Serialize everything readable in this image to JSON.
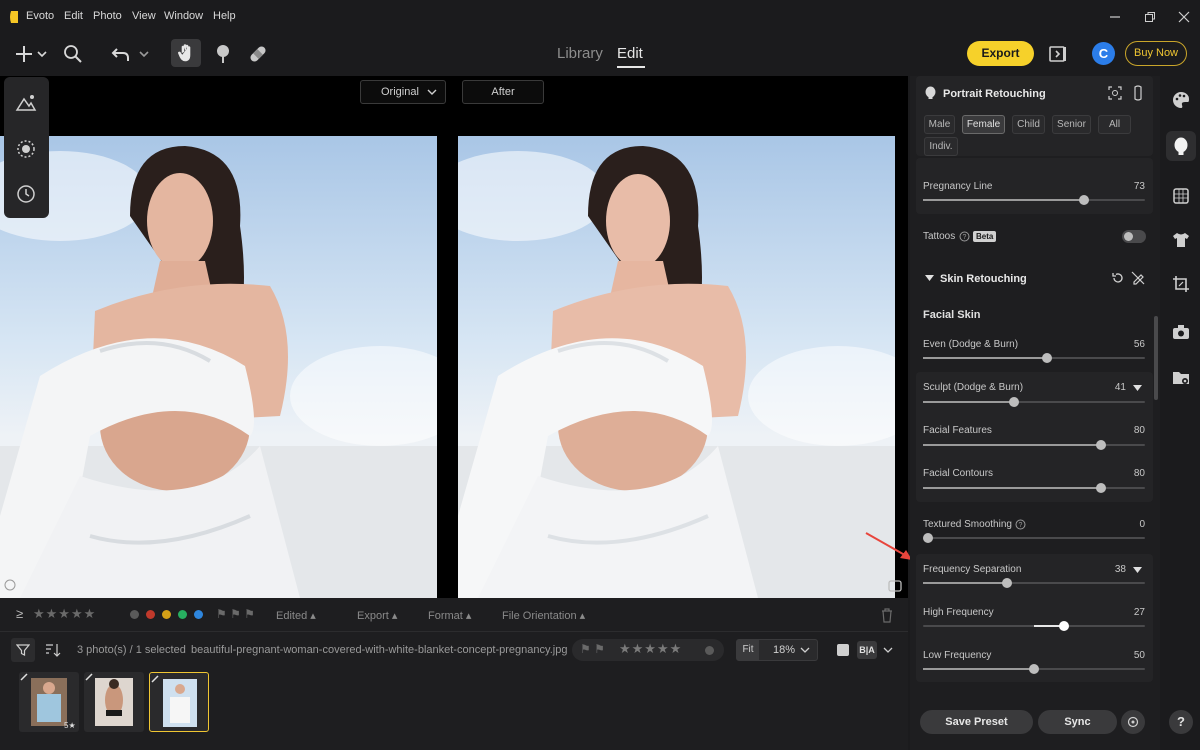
{
  "app": {
    "name": "Evoto",
    "menus": [
      "Edit",
      "Photo",
      "View",
      "Window",
      "Help"
    ]
  },
  "toolbar": {
    "modes": [
      "Library",
      "Edit"
    ],
    "active_mode": "Edit",
    "export_label": "Export",
    "avatar_letter": "C",
    "buy_now_label": "Buy Now"
  },
  "canvas": {
    "compare_left": "Original",
    "compare_right": "After"
  },
  "filter_bar": {
    "edited_label": "Edited",
    "export_label": "Export",
    "format_label": "Format",
    "orientation_label": "File Orientation",
    "color_labels": [
      "#5a5a5a",
      "#c0392b",
      "#d4a017",
      "#27ae60",
      "#2e86de"
    ]
  },
  "info_bar": {
    "count": "3 photo(s) / 1 selected",
    "filename": "beautiful-pregnant-woman-covered-with-white-blanket-concept-pregnancy.jpg",
    "fit_label": "Fit",
    "zoom": "18%"
  },
  "panel": {
    "title": "Portrait Retouching",
    "chips": [
      "Male",
      "Female",
      "Child",
      "Senior",
      "All",
      "Indiv."
    ],
    "selected_chip": "Female",
    "pregnancy_line": {
      "label": "Pregnancy Line",
      "value": "73"
    },
    "tattoos": {
      "label": "Tattoos",
      "badge": "Beta"
    },
    "section_skin": "Skin Retouching",
    "facial_skin": "Facial Skin",
    "sliders": [
      {
        "label": "Even (Dodge & Burn)",
        "value": "56"
      },
      {
        "label": "Sculpt (Dodge & Burn)",
        "value": "41"
      },
      {
        "label": "Facial Features",
        "value": "80"
      },
      {
        "label": "Facial Contours",
        "value": "80"
      },
      {
        "label": "Textured Smoothing",
        "value": "0"
      },
      {
        "label": "Frequency Separation",
        "value": "38"
      },
      {
        "label": "High Frequency",
        "value": "27"
      },
      {
        "label": "Low Frequency",
        "value": "50"
      }
    ],
    "save_preset": "Save Preset",
    "sync": "Sync"
  }
}
